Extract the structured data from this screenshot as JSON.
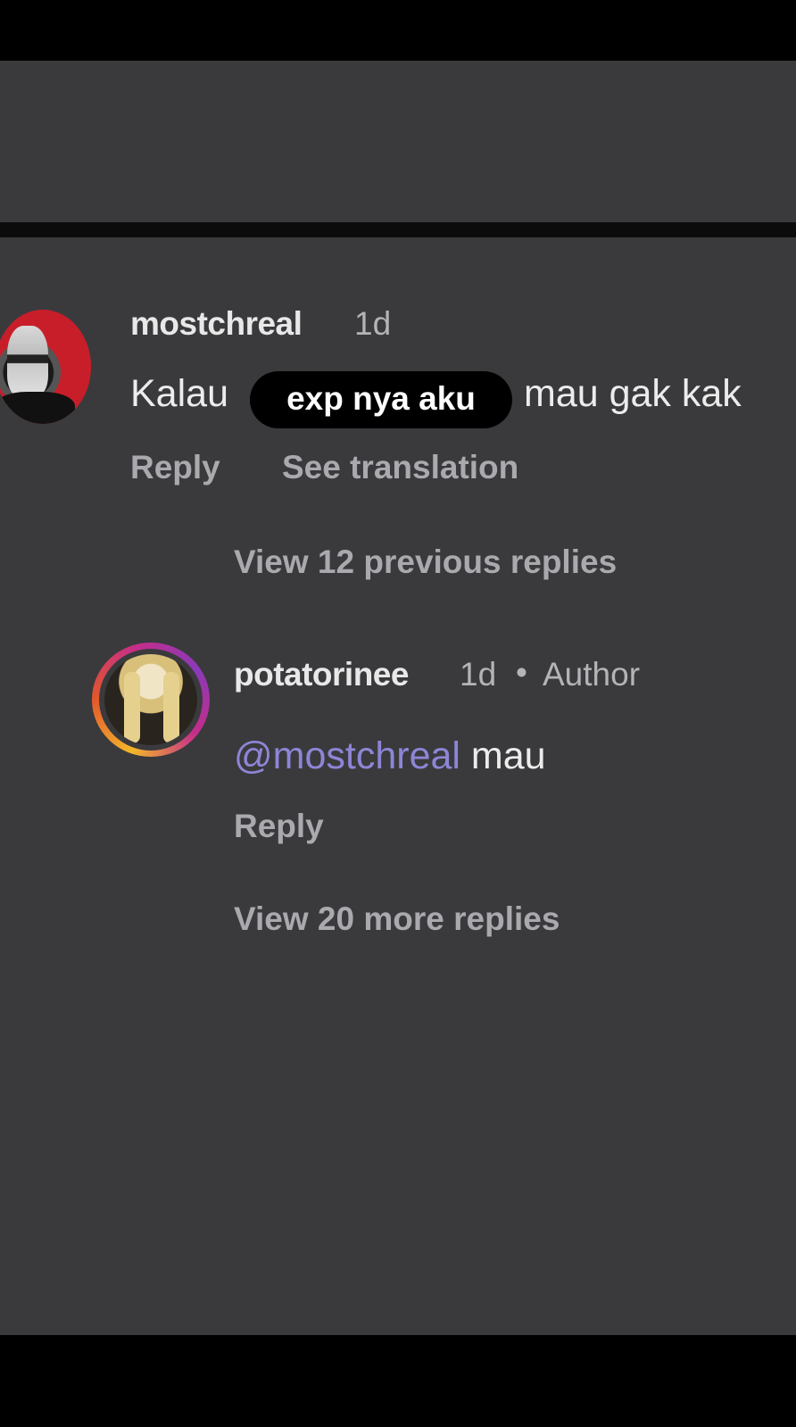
{
  "thread": {
    "comment": {
      "username": "mostchreal",
      "time": "1d",
      "text_before": "Kalau",
      "censor_label": "exp nya aku",
      "text_after": "mau gak kak",
      "reply_label": "Reply",
      "translate_label": "See translation"
    },
    "view_previous_label": "View 12 previous replies",
    "reply": {
      "username": "potatorinee",
      "time": "1d",
      "separator": "•",
      "author_badge": "Author",
      "mention": "@mostchreal",
      "text": "mau",
      "reply_label": "Reply"
    },
    "view_more_label": "View 20 more replies"
  },
  "colors": {
    "background": "#3a3a3d",
    "mention": "#8d86d6",
    "avatar_1_accent": "#c81e2a",
    "story_ring": [
      "#f3b72a",
      "#e2562d",
      "#c52d8a",
      "#8a3ab8"
    ]
  }
}
